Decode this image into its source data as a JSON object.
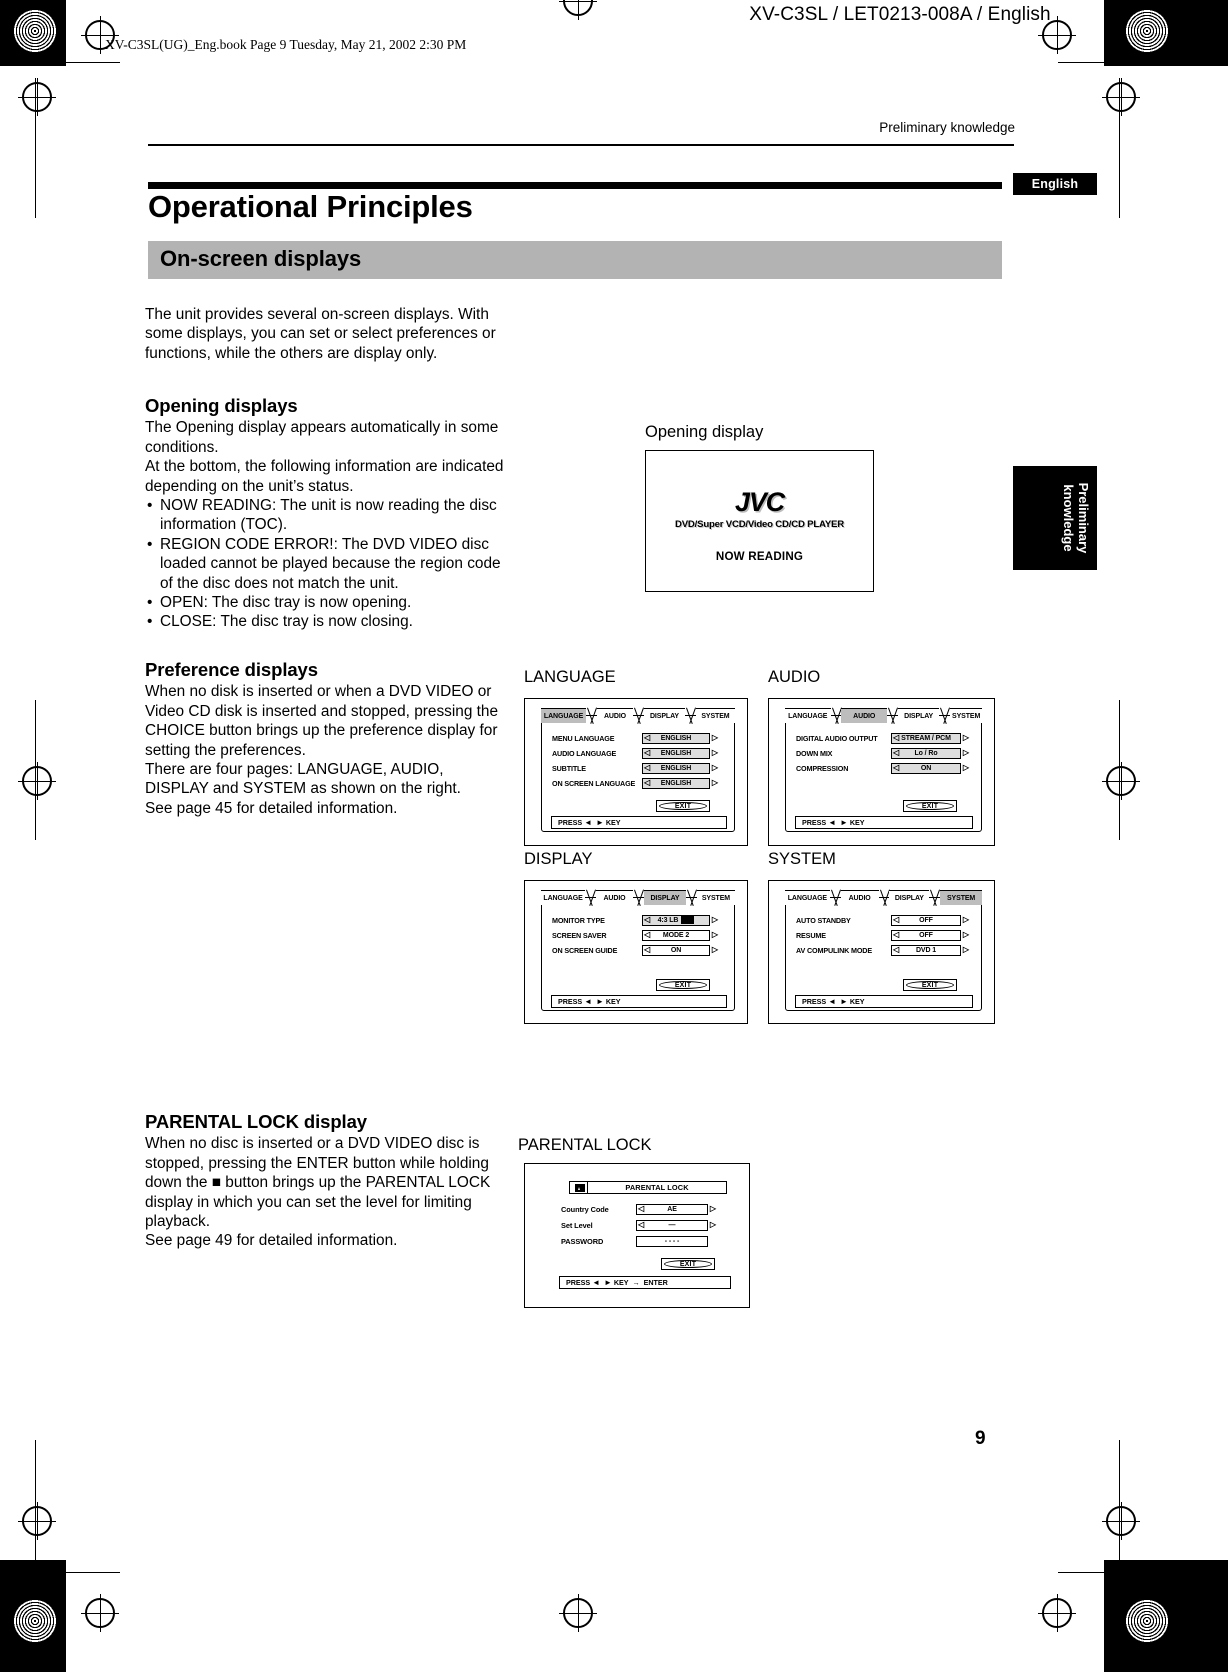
{
  "header": {
    "doc_code": "XV-C3SL / LET0213-008A / English",
    "file_line": "XV-C3SL(UG)_Eng.book  Page 9  Tuesday, May 21, 2002  2:30 PM",
    "running_head": "Preliminary knowledge",
    "english_tab": "English",
    "side_tab_line1": "Preliminary",
    "side_tab_line2": "knowledge",
    "page_number": "9"
  },
  "title": {
    "page_title": "Operational Principles",
    "section_title": "On-screen displays"
  },
  "body": {
    "intro": "The unit provides several on-screen displays. With some displays, you can set or select preferences or functions, while the others are display only.",
    "opening_heading": "Opening displays",
    "opening_p1": "The Opening display appears automatically in some conditions.",
    "opening_p2": "At the bottom, the following information are indicated depending on the unit’s status.",
    "opening_bullets": [
      "NOW READING: The unit is now reading the disc information (TOC).",
      "REGION CODE ERROR!: The DVD VIDEO disc loaded cannot be played because the region code of the disc does not match the unit.",
      "OPEN: The disc tray is now opening.",
      "CLOSE: The disc tray is now closing."
    ],
    "pref_heading": "Preference displays",
    "pref_p1": "When no disk is inserted or when a DVD VIDEO or Video CD disk is inserted and stopped, pressing the CHOICE button brings up the preference display for setting the preferences.",
    "pref_p2": "There are four pages: LANGUAGE, AUDIO, DISPLAY and SYSTEM as shown on the right.",
    "pref_p3": "See page 45 for detailed information.",
    "parental_heading": "PARENTAL LOCK display",
    "parental_p1": "When no disc is inserted or a DVD VIDEO disc is stopped, pressing the ENTER button while holding down the ■ button brings up the PARENTAL LOCK display in which you can set the level for limiting playback.",
    "parental_p2": "See page 49 for detailed information."
  },
  "opening_display": {
    "caption": "Opening display",
    "logo": "JVC",
    "sub": "DVD/Super VCD/Video CD/CD PLAYER",
    "status": "NOW READING"
  },
  "preference_screens": [
    {
      "caption": "LANGUAGE",
      "tabs": [
        "LANGUAGE",
        "AUDIO",
        "DISPLAY",
        "SYSTEM"
      ],
      "selected_tab": "LANGUAGE",
      "rows": [
        {
          "label": "MENU LANGUAGE",
          "value": "ENGLISH"
        },
        {
          "label": "AUDIO LANGUAGE",
          "value": "ENGLISH"
        },
        {
          "label": "SUBTITLE",
          "value": "ENGLISH"
        },
        {
          "label": "ON SCREEN LANGUAGE",
          "value": "ENGLISH"
        }
      ],
      "exit_label": "EXIT",
      "press_key": "PRESS",
      "press_key_suffix": "KEY"
    },
    {
      "caption": "AUDIO",
      "tabs": [
        "LANGUAGE",
        "AUDIO",
        "DISPLAY",
        "SYSTEM"
      ],
      "selected_tab": "AUDIO",
      "rows": [
        {
          "label": "DIGITAL AUDIO OUTPUT",
          "value": "STREAM / PCM"
        },
        {
          "label": "DOWN MIX",
          "value": "Lo / Ro"
        },
        {
          "label": "COMPRESSION",
          "value": "ON"
        }
      ],
      "exit_label": "EXIT",
      "press_key": "PRESS",
      "press_key_suffix": "KEY"
    },
    {
      "caption": "DISPLAY",
      "tabs": [
        "LANGUAGE",
        "AUDIO",
        "DISPLAY",
        "SYSTEM"
      ],
      "selected_tab": "DISPLAY",
      "rows": [
        {
          "label": "MONITOR TYPE",
          "value": "4:3 LB",
          "icon": "letterbox-icon"
        },
        {
          "label": "SCREEN SAVER",
          "value": "MODE 2"
        },
        {
          "label": "ON SCREEN GUIDE",
          "value": "ON"
        }
      ],
      "exit_label": "EXIT",
      "press_key": "PRESS",
      "press_key_suffix": "KEY"
    },
    {
      "caption": "SYSTEM",
      "tabs": [
        "LANGUAGE",
        "AUDIO",
        "DISPLAY",
        "SYSTEM"
      ],
      "selected_tab": "SYSTEM",
      "rows": [
        {
          "label": "AUTO STANDBY",
          "value": "OFF"
        },
        {
          "label": "RESUME",
          "value": "OFF"
        },
        {
          "label": "AV COMPULINK MODE",
          "value": "DVD 1"
        }
      ],
      "exit_label": "EXIT",
      "press_key": "PRESS",
      "press_key_suffix": "KEY"
    }
  ],
  "parental_lock_screen": {
    "caption": "PARENTAL LOCK",
    "header_title": "PARENTAL LOCK",
    "rows": [
      {
        "label": "Country Code",
        "value": "AE"
      },
      {
        "label": "Set Level",
        "value": "—"
      },
      {
        "label": "PASSWORD",
        "value": "- - - -"
      }
    ],
    "exit_label": "EXIT",
    "press_key": "PRESS",
    "press_key_suffix": "KEY",
    "press_key_enter": "ENTER"
  }
}
